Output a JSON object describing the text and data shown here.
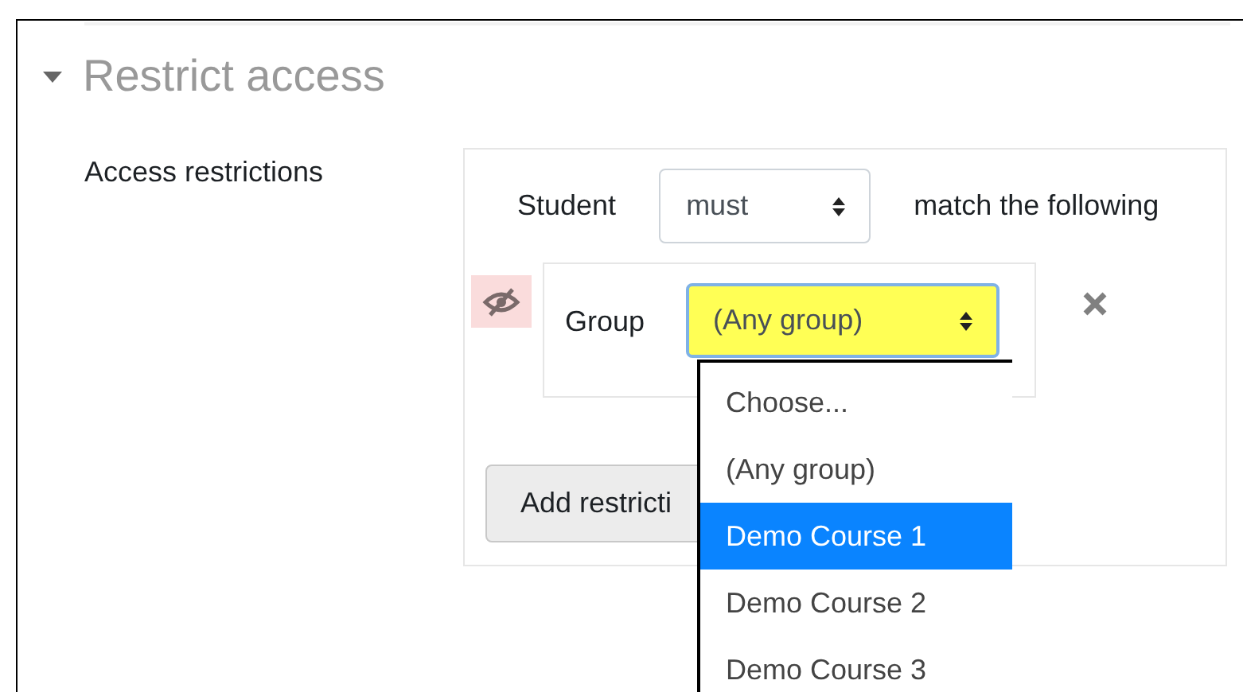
{
  "section": {
    "title": "Restrict access",
    "expanded": true
  },
  "field_label": "Access restrictions",
  "match": {
    "subject": "Student",
    "mode": "must",
    "suffix": "match the following"
  },
  "conditions": [
    {
      "hidden": true,
      "label": "Group",
      "value": "(Any group)"
    }
  ],
  "add_button": "Add restricti",
  "dropdown": {
    "options": [
      {
        "label": "Choose...",
        "selected": false
      },
      {
        "label": "(Any group)",
        "selected": false
      },
      {
        "label": "Demo Course 1",
        "selected": true
      },
      {
        "label": "Demo Course 2",
        "selected": false
      },
      {
        "label": "Demo Course 3",
        "selected": false
      }
    ]
  }
}
